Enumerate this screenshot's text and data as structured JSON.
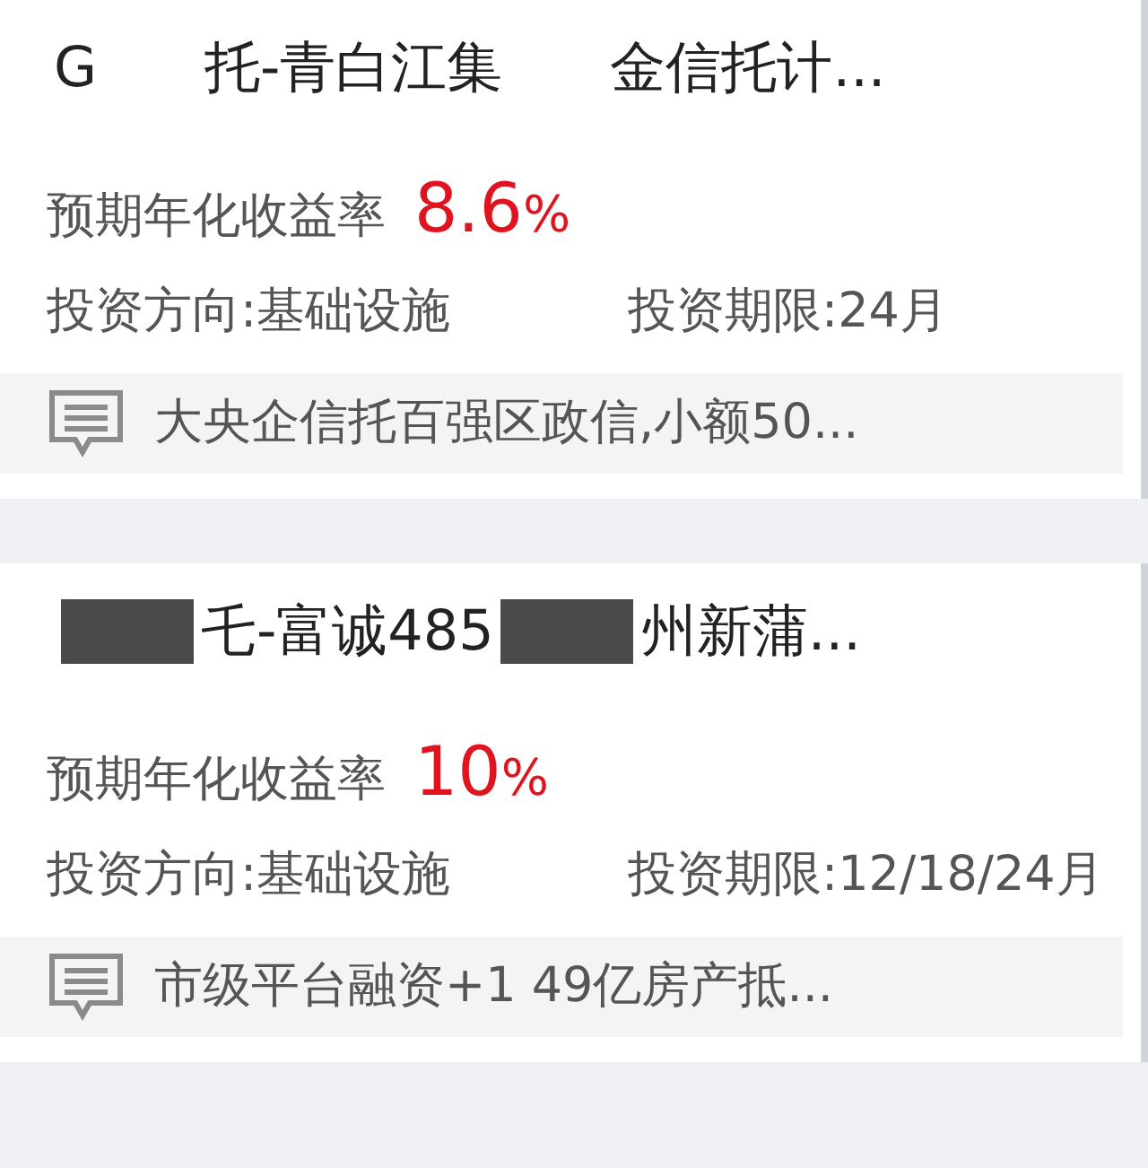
{
  "products": [
    {
      "title_parts": [
        {
          "kind": "text",
          "text": "G"
        },
        {
          "kind": "blur"
        },
        {
          "kind": "text",
          "text": "托-青白江集"
        },
        {
          "kind": "blur"
        },
        {
          "kind": "text",
          "text": "金信托计..."
        }
      ],
      "rate_label": "预期年化收益率",
      "rate_value": "8.6",
      "rate_unit": "%",
      "direction": "投资方向:基础设施",
      "term": "投资期限:24月",
      "note": "大央企信托百强区政信,小额50..."
    },
    {
      "title_parts": [
        {
          "kind": "redacted"
        },
        {
          "kind": "text",
          "text": "乇-富诚485"
        },
        {
          "kind": "redacted"
        },
        {
          "kind": "text",
          "text": "州新蒲..."
        }
      ],
      "rate_label": "预期年化收益率",
      "rate_value": "10",
      "rate_unit": "%",
      "direction": "投资方向:基础设施",
      "term": "投资期限:12/18/24月",
      "note": "市级平台融资+1 49亿房产抵..."
    }
  ]
}
